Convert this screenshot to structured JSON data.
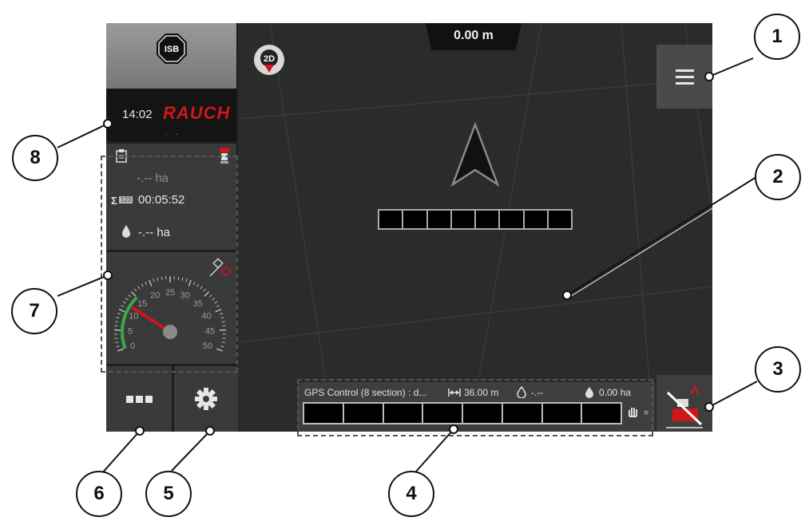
{
  "isb": {
    "label": "ISB"
  },
  "status": {
    "time": "14:02",
    "brand": "RAUCH",
    "dots": ". ."
  },
  "info": {
    "area": "-.-- ha",
    "sum_prefix": "Σ",
    "sum_badge": "123",
    "sum_time": "00:05:52",
    "area2": "-.-- ha"
  },
  "speedo": {
    "ticks": [
      "0",
      "5",
      "10",
      "15",
      "20",
      "25",
      "30",
      "35",
      "40",
      "45",
      "50"
    ],
    "needle_value": 12
  },
  "map": {
    "distance": "0.00 m",
    "view_mode": "2D"
  },
  "gps_bar": {
    "title": "GPS Control (8 section) : d...",
    "width": "36.00 m",
    "rate": "-.--",
    "total_area": "0.00 ha",
    "sections": 8
  },
  "boom": {
    "sections": 8
  },
  "callouts": [
    "1",
    "2",
    "3",
    "4",
    "5",
    "6",
    "7",
    "8"
  ],
  "icons": {
    "isb": "isb-stop-icon",
    "menu": "hamburger-menu-icon",
    "compass": "compass-2d-icon",
    "arrow": "navigation-arrow-icon",
    "clipboard": "clipboard-icon",
    "spreader": "spreader-icon",
    "gps": "gps-satellite-icon",
    "settings": "gear-icon",
    "more": "more-squares-icon",
    "width": "working-width-icon",
    "hand": "manual-hand-icon",
    "fertilizer": "fertilizer-drop-icon",
    "section-control": "section-control-icon"
  },
  "colors": {
    "brand": "#d0161b",
    "speed_green": "#3aa84a",
    "needle": "#d0161b"
  }
}
